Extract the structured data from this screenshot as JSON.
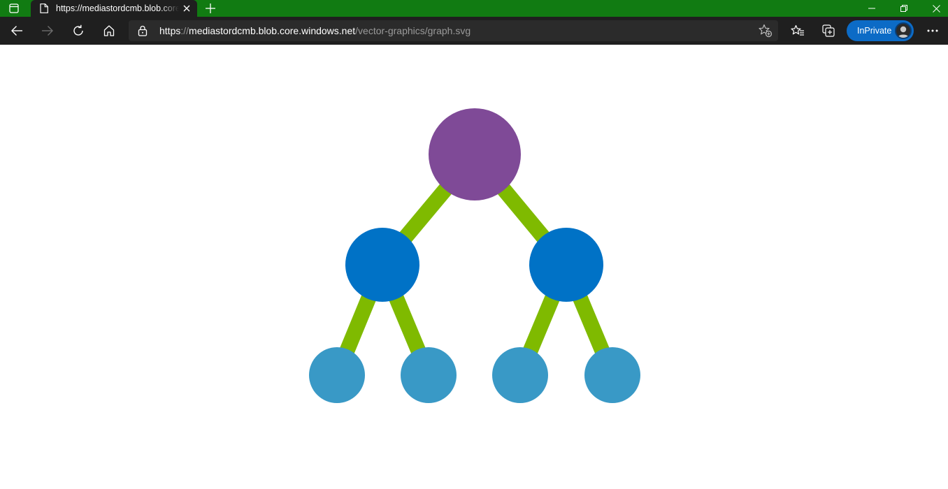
{
  "browser": {
    "tab": {
      "title": "https://mediastordcmb.blob.core.windows.net/vector-graphics/graph.svg"
    },
    "address": {
      "scheme": "https",
      "separator": "://",
      "host": "mediastordcmb.blob.core.windows.net",
      "path": "/vector-graphics/graph.svg"
    },
    "inprivate_label": "InPrivate",
    "colors": {
      "titlebar": "#117b12",
      "toolbar": "#1f1f1f",
      "inprivate": "#0c6bc6"
    }
  },
  "graph": {
    "colors": {
      "root": "#7f4a97",
      "middle": "#0072c6",
      "leaf": "#3999c6",
      "edge": "#7fba00"
    },
    "nodes": [
      {
        "id": "root",
        "level": "root"
      },
      {
        "id": "left-child",
        "level": "middle"
      },
      {
        "id": "right-child",
        "level": "middle"
      },
      {
        "id": "leaf-1",
        "level": "leaf"
      },
      {
        "id": "leaf-2",
        "level": "leaf"
      },
      {
        "id": "leaf-3",
        "level": "leaf"
      },
      {
        "id": "leaf-4",
        "level": "leaf"
      }
    ],
    "edges": [
      [
        "root",
        "left-child"
      ],
      [
        "root",
        "right-child"
      ],
      [
        "left-child",
        "leaf-1"
      ],
      [
        "left-child",
        "leaf-2"
      ],
      [
        "right-child",
        "leaf-3"
      ],
      [
        "right-child",
        "leaf-4"
      ]
    ]
  }
}
